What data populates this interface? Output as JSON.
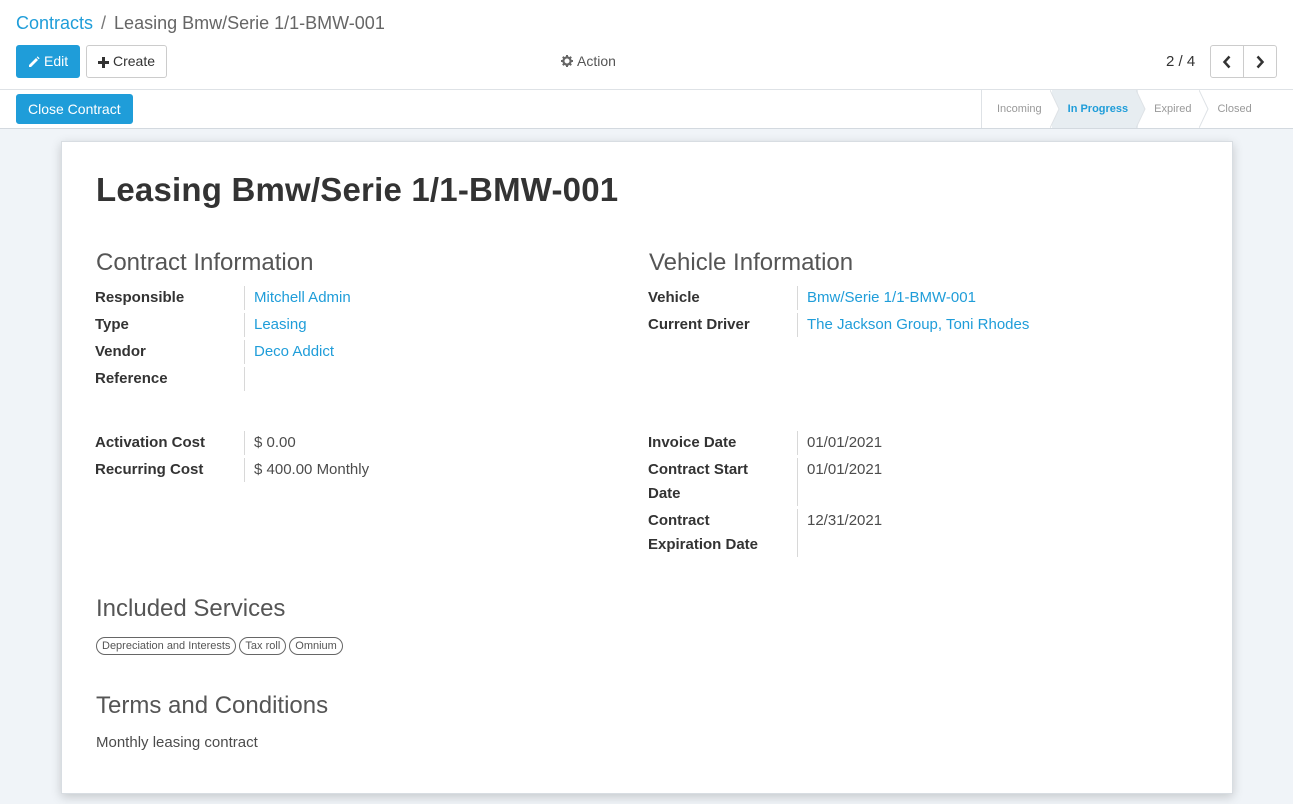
{
  "breadcrumb": {
    "parent": "Contracts",
    "separator": "/",
    "current": "Leasing Bmw/Serie 1/1-BMW-001"
  },
  "toolbar": {
    "edit_label": "Edit",
    "create_label": "Create",
    "action_label": "Action"
  },
  "pager": {
    "value": "2 / 4"
  },
  "statusbar": {
    "close_button_label": "Close Contract",
    "stages": [
      "Incoming",
      "In Progress",
      "Expired",
      "Closed"
    ],
    "active_stage": "In Progress"
  },
  "record": {
    "title": "Leasing Bmw/Serie 1/1-BMW-001",
    "contract_section": {
      "title": "Contract Information",
      "responsible_label": "Responsible",
      "responsible_value": "Mitchell Admin",
      "type_label": "Type",
      "type_value": "Leasing",
      "vendor_label": "Vendor",
      "vendor_value": "Deco Addict",
      "reference_label": "Reference",
      "reference_value": ""
    },
    "vehicle_section": {
      "title": "Vehicle Information",
      "vehicle_label": "Vehicle",
      "vehicle_value": "Bmw/Serie 1/1-BMW-001",
      "driver_label": "Current Driver",
      "driver_value": "The Jackson Group, Toni Rhodes"
    },
    "costs": {
      "activation_label": "Activation Cost",
      "activation_value": "$ 0.00",
      "recurring_label": "Recurring Cost",
      "recurring_value": "$ 400.00",
      "recurring_frequency": "Monthly"
    },
    "dates": {
      "invoice_label": "Invoice Date",
      "invoice_value": "01/01/2021",
      "start_label_1": "Contract Start",
      "start_label_2": "Date",
      "start_value": "01/01/2021",
      "expiration_label_1": "Contract",
      "expiration_label_2": "Expiration Date",
      "expiration_value": "12/31/2021"
    },
    "services": {
      "title": "Included Services",
      "tags": [
        "Depreciation and Interests",
        "Tax roll",
        "Omnium"
      ]
    },
    "terms": {
      "title": "Terms and Conditions",
      "text": "Monthly leasing contract"
    }
  },
  "colors": {
    "primary": "#1f9dd9",
    "background": "#f0f4f8",
    "active_stage_bg": "#e7edf1"
  },
  "icons": {
    "edit": "pencil-icon",
    "create": "plus-icon",
    "action": "gear-icon",
    "prev": "chevron-left-icon",
    "next": "chevron-right-icon"
  }
}
